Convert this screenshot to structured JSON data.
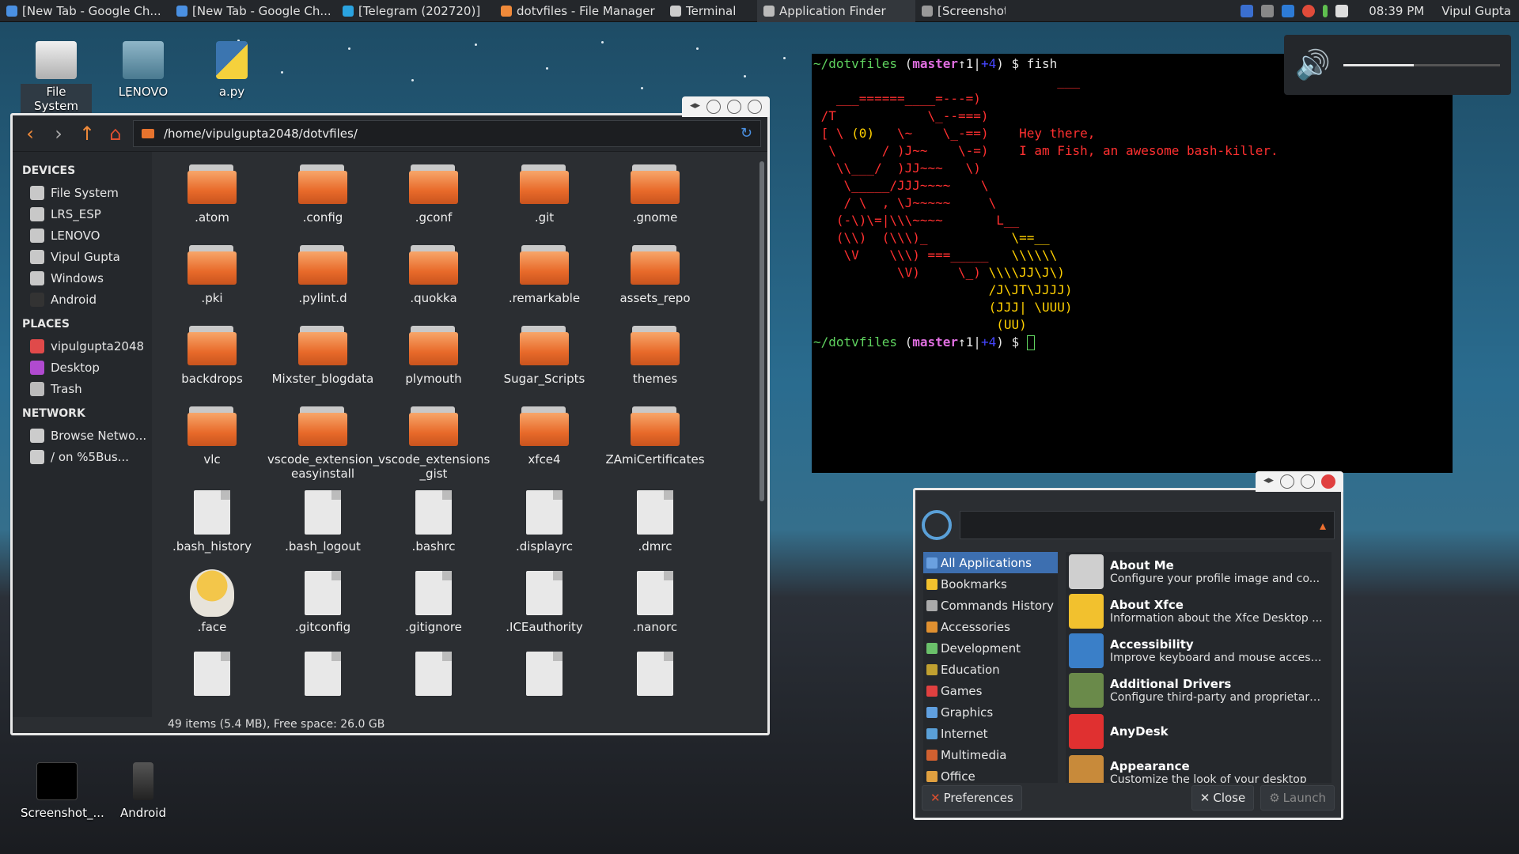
{
  "panel": {
    "tasks": [
      {
        "label": "[New Tab - Google Ch...",
        "color": "#4a90e2"
      },
      {
        "label": "[New Tab - Google Ch...",
        "color": "#4a90e2"
      },
      {
        "label": "[Telegram (202720)]",
        "color": "#2aa3e0"
      },
      {
        "label": "dotvfiles - File Manager",
        "color": "#f08a3a"
      },
      {
        "label": "Terminal",
        "color": "#cccccc"
      },
      {
        "label": "Application Finder",
        "color": "#bbbbbb"
      },
      {
        "label": "[Screenshot]",
        "color": "#999999"
      }
    ],
    "active_task": "Application Finder",
    "clock": "08:39 PM",
    "user": "Vipul Gupta",
    "tray_icons": [
      "bluetooth-icon",
      "wifi-icon",
      "r-app-icon",
      "chrome-icon",
      "battery-icon",
      "volume-icon"
    ]
  },
  "desktop": {
    "icons_top": [
      "File System",
      "LENOVO",
      "a.py"
    ],
    "icons_bottom": [
      "Screenshot_...",
      "Android"
    ]
  },
  "file_manager": {
    "path": "/home/vipulgupta2048/dotvfiles/",
    "sidebar": {
      "devices_header": "DEVICES",
      "devices": [
        "File System",
        "LRS_ESP",
        "LENOVO",
        "Vipul Gupta",
        "Windows",
        "Android"
      ],
      "places_header": "PLACES",
      "places": [
        "vipulgupta2048",
        "Desktop",
        "Trash"
      ],
      "network_header": "NETWORK",
      "network": [
        "Browse Netwo...",
        "/ on %5Bus..."
      ]
    },
    "items": [
      {
        "name": ".atom",
        "type": "folder"
      },
      {
        "name": ".config",
        "type": "folder"
      },
      {
        "name": ".gconf",
        "type": "folder"
      },
      {
        "name": ".git",
        "type": "folder"
      },
      {
        "name": ".gnome",
        "type": "folder"
      },
      {
        "name": ".pki",
        "type": "folder"
      },
      {
        "name": ".pylint.d",
        "type": "folder"
      },
      {
        "name": ".quokka",
        "type": "folder"
      },
      {
        "name": ".remarkable",
        "type": "folder"
      },
      {
        "name": "assets_repo",
        "type": "folder"
      },
      {
        "name": "backdrops",
        "type": "folder"
      },
      {
        "name": "Mixster_blogdata",
        "type": "folder"
      },
      {
        "name": "plymouth",
        "type": "folder"
      },
      {
        "name": "Sugar_Scripts",
        "type": "folder"
      },
      {
        "name": "themes",
        "type": "folder"
      },
      {
        "name": "vlc",
        "type": "folder"
      },
      {
        "name": "vscode_extension_ easyinstall",
        "type": "folder"
      },
      {
        "name": "vscode_extensions _gist",
        "type": "folder"
      },
      {
        "name": "xfce4",
        "type": "folder"
      },
      {
        "name": "ZAmiCertificates",
        "type": "folder"
      },
      {
        "name": ".bash_history",
        "type": "file"
      },
      {
        "name": ".bash_logout",
        "type": "file"
      },
      {
        "name": ".bashrc",
        "type": "file"
      },
      {
        "name": ".displayrc",
        "type": "file"
      },
      {
        "name": ".dmrc",
        "type": "file"
      },
      {
        "name": ".face",
        "type": "image"
      },
      {
        "name": ".gitconfig",
        "type": "file"
      },
      {
        "name": ".gitignore",
        "type": "file"
      },
      {
        "name": ".ICEauthority",
        "type": "binary"
      },
      {
        "name": ".nanorc",
        "type": "file"
      },
      {
        "name": "",
        "type": "file"
      },
      {
        "name": "",
        "type": "file"
      },
      {
        "name": "",
        "type": "file"
      },
      {
        "name": "",
        "type": "file"
      },
      {
        "name": "",
        "type": "file"
      }
    ],
    "status": "49 items (5.4 MB), Free space: 26.0 GB"
  },
  "terminal": {
    "lines": [
      [
        [
          "g",
          "~/dotvfiles "
        ],
        [
          "w",
          "("
        ],
        [
          "m",
          "master"
        ],
        [
          "w",
          "↑1|"
        ],
        [
          "b",
          "+4"
        ],
        [
          "w",
          ") $ fish"
        ]
      ],
      [
        [
          "r",
          "                                ___"
        ]
      ],
      [
        [
          "r",
          "   ___======____=---=)"
        ]
      ],
      [
        [
          "r",
          " /T            \\_--===)"
        ]
      ],
      [
        [
          "r",
          " [ \\ "
        ],
        [
          "y",
          "(0)"
        ],
        [
          "r",
          "   \\~    \\_-==)    "
        ],
        [
          "r",
          "Hey there,"
        ]
      ],
      [
        [
          "r",
          "  \\      / )J~~    \\-=)    I am Fish, an awesome bash-killer."
        ]
      ],
      [
        [
          "r",
          "   \\\\___/  )JJ~~~   \\)"
        ]
      ],
      [
        [
          "r",
          "    \\_____/JJJ~~~~    \\"
        ]
      ],
      [
        [
          "r",
          "    / \\  , \\J~~~~~     \\"
        ]
      ],
      [
        [
          "r",
          "   (-\\)\\=|\\\\\\~~~~       L__"
        ]
      ],
      [
        [
          "r",
          "   (\\\\)  (\\\\\\)_           "
        ],
        [
          "y",
          "\\==__"
        ]
      ],
      [
        [
          "r",
          "    \\V    \\\\\\) ===_____   "
        ],
        [
          "y",
          "\\\\\\\\\\\\"
        ]
      ],
      [
        [
          "r",
          "           \\V)     \\_) "
        ],
        [
          "y",
          "\\\\\\\\JJ\\J\\)"
        ]
      ],
      [
        [
          "r",
          "                       "
        ],
        [
          "y",
          "/J\\JT\\JJJJ)"
        ]
      ],
      [
        [
          "r",
          "                       "
        ],
        [
          "y",
          "(JJJ| \\UUU)"
        ]
      ],
      [
        [
          "r",
          "                        "
        ],
        [
          "y",
          "(UU)"
        ]
      ],
      [
        [
          "g",
          "~/dotvfiles "
        ],
        [
          "w",
          "("
        ],
        [
          "m",
          "master"
        ],
        [
          "w",
          "↑1|"
        ],
        [
          "b",
          "+4"
        ],
        [
          "w",
          ") $ "
        ],
        [
          "cursor",
          ""
        ]
      ]
    ]
  },
  "volume": {
    "level": 0.45
  },
  "app_finder": {
    "categories": [
      "All Applications",
      "Bookmarks",
      "Commands History",
      "Accessories",
      "Development",
      "Education",
      "Games",
      "Graphics",
      "Internet",
      "Multimedia",
      "Office"
    ],
    "selected_category": "All Applications",
    "apps": [
      {
        "name": "About Me",
        "desc": "Configure your profile image and co...",
        "color": "#cfcfcf"
      },
      {
        "name": "About Xfce",
        "desc": "Information about the Xfce Desktop ...",
        "color": "#f2c12e"
      },
      {
        "name": "Accessibility",
        "desc": "Improve keyboard and mouse access...",
        "color": "#3a7fc8"
      },
      {
        "name": "Additional Drivers",
        "desc": "Configure third-party and proprietary...",
        "color": "#6a8a4a"
      },
      {
        "name": "AnyDesk",
        "desc": "",
        "color": "#e03030"
      },
      {
        "name": "Appearance",
        "desc": "Customize the look of your desktop",
        "color": "#c88a3a"
      }
    ],
    "preferences_label": "Preferences",
    "close_label": "Close",
    "launch_label": "Launch"
  }
}
